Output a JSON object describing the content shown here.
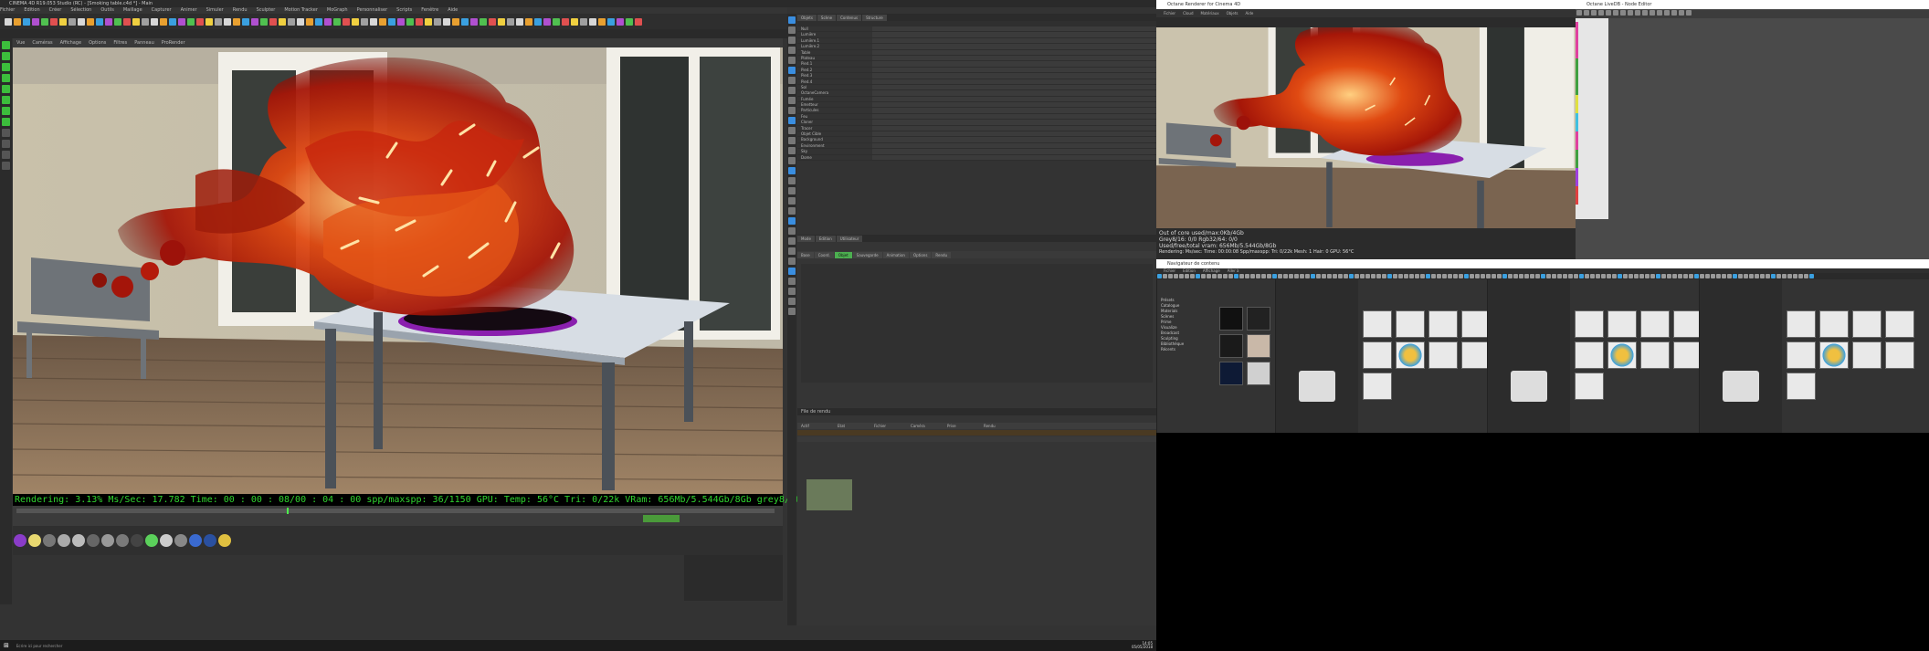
{
  "main_window": {
    "title": "CINEMA 4D R19.053 Studio (RC) - [Smoking table.c4d *] - Main",
    "menus": [
      "Fichier",
      "Edition",
      "Créer",
      "Sélection",
      "Outils",
      "Maillage",
      "Capturer",
      "Animer",
      "Simuler",
      "Rendu",
      "Sculpter",
      "Motion Tracker",
      "MoGraph",
      "Personnaliser",
      "Scripts",
      "Fenêtre",
      "Aide"
    ],
    "viewport_menus": [
      "Vue",
      "Caméras",
      "Affichage",
      "Options",
      "Filtres",
      "Panneau",
      "ProRender"
    ]
  },
  "render_status": {
    "text": "Rendering: 3.13% Ms/Sec: 17.782 Time: 00 : 00 : 08/00 : 04 : 00 spp/maxspp: 36/1150 GPU:  Temp: 56°C Tri: 0/22k VRam: 656Mb/5.544Gb/8Gb grey8/16: 0/0 rgb32/64: 0/0"
  },
  "object_manager": {
    "tabs": [
      "Objets",
      "Scène",
      "Contenus",
      "Structure"
    ],
    "objects": [
      "Null",
      "Lumière",
      "Lumière.1",
      "Lumière.2",
      "Table",
      "Plateau",
      "Pied.1",
      "Pied.2",
      "Pied.3",
      "Pied.4",
      "Sol",
      "OctaneCamera",
      "Fumée",
      "Emetteur",
      "Particules",
      "Feu",
      "Cloner",
      "Tracer",
      "Objet Cible",
      "Background",
      "Environment",
      "Sky",
      "Dome"
    ]
  },
  "attributes": {
    "tabs": [
      "Mode",
      "Edition",
      "Utilisateur"
    ],
    "sections": [
      "Base",
      "Coord.",
      "Objet",
      "Sauvegarde",
      "Animation",
      "Options",
      "Rendu"
    ]
  },
  "render_queue": {
    "title": "File de rendu",
    "columns": [
      "Actif",
      "Etat",
      "Fichier",
      "Caméra",
      "Prise",
      "Rendu"
    ]
  },
  "interactive_render": {
    "title": "Octane Renderer for Cinema 4D",
    "menus": [
      "Fichier",
      "Cloud",
      "Matériaux",
      "Objets",
      "Aide"
    ],
    "info_line1": "Out of core used/max:0Kb/4Gb",
    "info_line2": "Grey8/16: 0/0       Rgb32/64: 0/0",
    "info_line3": "Used/free/total vram: 656Mb/5.544Gb/8Gb",
    "info_line4": "Rendering:    Ms/sec:    Time: 00:00:08    Spp/maxspp:    Tri: 0/22k    Mesh: 1   Hair: 0    GPU: 56°C"
  },
  "color_window": {
    "title": "Octane LiveDB - Node Editor"
  },
  "content_browser": {
    "title": "Navigateur de contenu",
    "menus": [
      "Fichier",
      "Edition",
      "Affichage",
      "Aller à"
    ],
    "tree_items": [
      "Présets",
      "Catalogue",
      "Materials",
      "Scènes",
      "Prime",
      "Visualize",
      "Broadcast",
      "Sculpting",
      "Bibliothèque",
      "Récents"
    ]
  },
  "taskbar": {
    "search_placeholder": "Ecrire ici pour rechercher",
    "time": "14:05",
    "date": "05/05/2018"
  },
  "colors": {
    "fire_hot": "#ffd27a",
    "fire_mid": "#c8240c",
    "status_green": "#2fd52f",
    "panel": "#333333"
  }
}
